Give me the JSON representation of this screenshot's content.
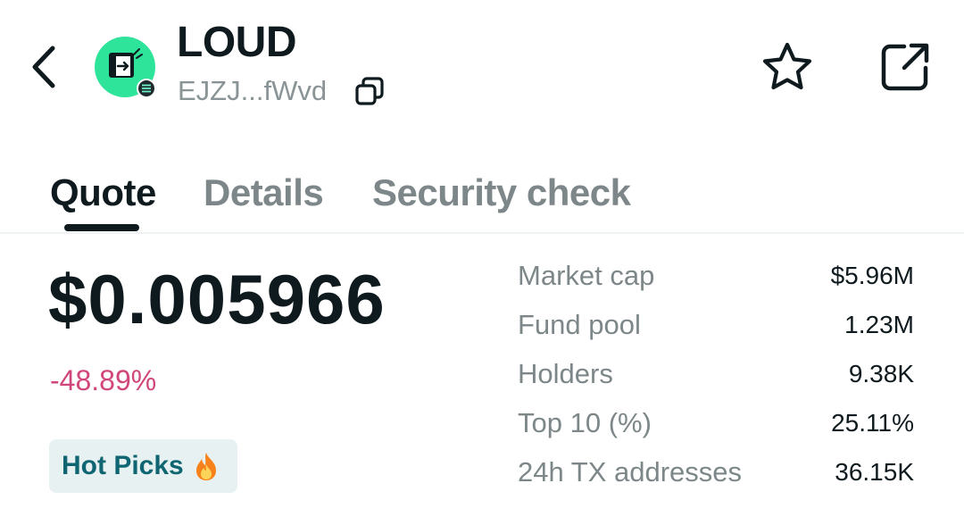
{
  "header": {
    "back_icon": "chevron-left-icon",
    "token_name": "LOUD",
    "token_address": "EJZJ...fWvd",
    "copy_icon": "copy-icon",
    "star_icon": "star-icon",
    "share_icon": "share-external-icon",
    "avatar_color": "#2ee39a",
    "chain_badge_icon": "solana-icon"
  },
  "tabs": [
    {
      "label": "Quote",
      "active": true
    },
    {
      "label": "Details",
      "active": false
    },
    {
      "label": "Security check",
      "active": false
    }
  ],
  "quote": {
    "price": "$0.005966",
    "change": "-48.89%",
    "change_color": "#d0457a",
    "badge_label": "Hot Picks",
    "badge_icon": "fire-icon"
  },
  "stats": [
    {
      "label": "Market cap",
      "value": "$5.96M"
    },
    {
      "label": "Fund pool",
      "value": "1.23M"
    },
    {
      "label": "Holders",
      "value": "9.38K"
    },
    {
      "label": "Top 10 (%)",
      "value": "25.11%"
    },
    {
      "label": "24h TX addresses",
      "value": "36.15K"
    }
  ]
}
